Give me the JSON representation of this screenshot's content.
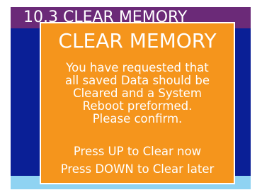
{
  "screen": {
    "header_title": "10.3  CLEAR MEMORY",
    "colors": {
      "background": "#0a1f96",
      "header": "#6b2a78",
      "dialog": "#f5951c",
      "bottom_strip": "#8fd3f2"
    }
  },
  "dialog": {
    "title": "CLEAR MEMORY",
    "message_lines": [
      "You have requested that",
      "all saved Data should be",
      "Cleared and a System",
      "Reboot preformed.",
      "Please confirm."
    ],
    "action_up": "Press UP to Clear now",
    "action_down": "Press DOWN to Clear later"
  }
}
